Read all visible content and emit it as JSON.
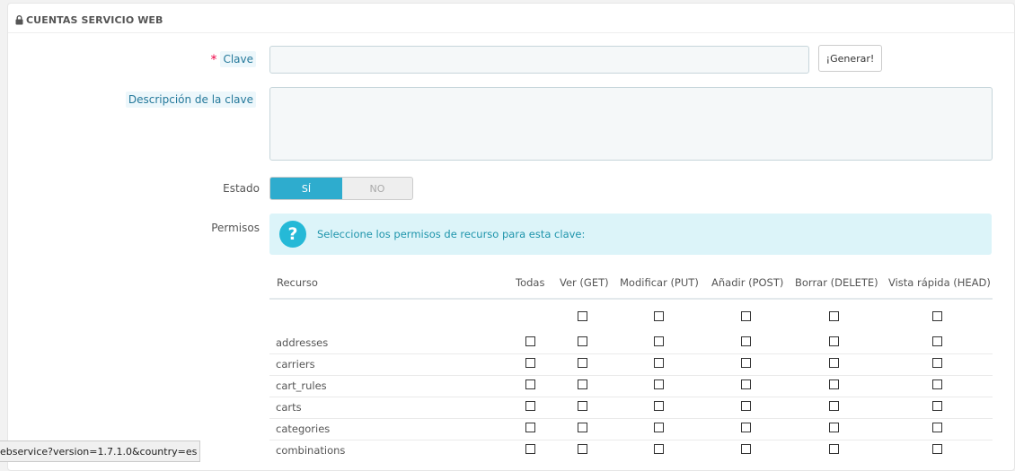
{
  "panel": {
    "title": "CUENTAS SERVICIO WEB"
  },
  "form": {
    "key_label": "Clave",
    "key_required_mark": "*",
    "key_value": "",
    "generate_button": "¡Generar!",
    "description_label": "Descripción de la clave",
    "description_value": "",
    "status_label": "Estado",
    "status_on": "SÍ",
    "status_off": "NO",
    "status_selected": "SÍ",
    "permissions_label": "Permisos",
    "permissions_info": "Seleccione los permisos de recurso para esta clave:"
  },
  "table": {
    "headers": [
      "Recurso",
      "Todas",
      "Ver (GET)",
      "Modificar (PUT)",
      "Añadir (POST)",
      "Borrar (DELETE)",
      "Vista rápida (HEAD)"
    ],
    "rows": [
      "addresses",
      "carriers",
      "cart_rules",
      "carts",
      "categories",
      "combinations"
    ]
  },
  "statusbar": {
    "url": "ebservice?version=1.7.1.0&country=es"
  },
  "colors": {
    "accent": "#2eacce",
    "info_bg": "#dcf4f9",
    "info_icon": "#25b9d7"
  }
}
